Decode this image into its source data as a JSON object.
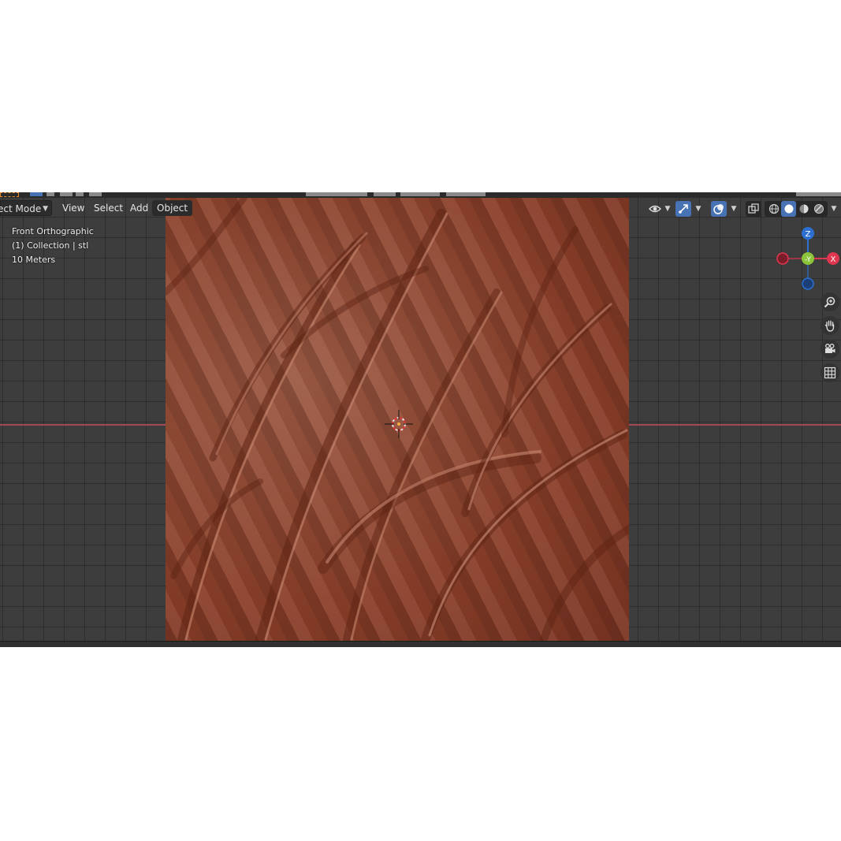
{
  "header": {
    "mode_label": "ect Mode",
    "menu": {
      "view": "View",
      "select": "Select",
      "add": "Add",
      "object": "Object"
    }
  },
  "viewport_info": {
    "view_name": "Front Orthographic",
    "collection": "(1) Collection | stl",
    "scale": "10 Meters"
  },
  "gizmo": {
    "z_label": "Z",
    "y_label": "-Y",
    "x_label": "X",
    "z_color": "#2c6fd1",
    "y_color": "#8cc43b",
    "x_color": "#e0364f"
  },
  "colors": {
    "viewport_bg": "#3d3d3d",
    "model": "#8a4330",
    "accent": "#4772b3"
  },
  "icons": {
    "visibility": "eye-icon",
    "gizmo_toggle": "gizmo-icon",
    "overlays": "overlay-icon",
    "xray": "xray-icon",
    "shading": [
      "wireframe-shading-icon",
      "solid-shading-icon",
      "material-shading-icon",
      "rendered-shading-icon"
    ],
    "nav": [
      "zoom-icon",
      "hand-icon",
      "camera-icon",
      "grid-icon"
    ]
  }
}
